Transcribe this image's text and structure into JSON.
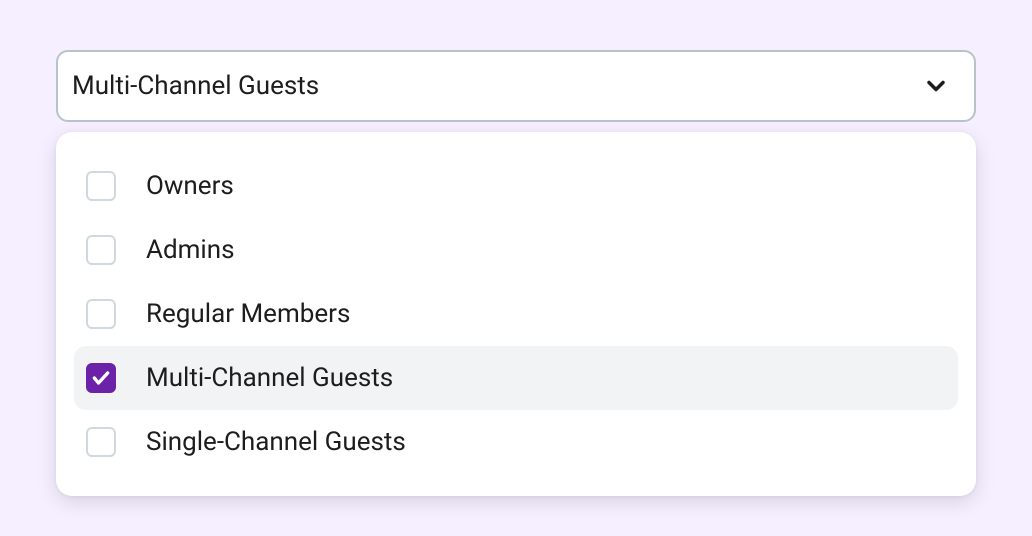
{
  "select": {
    "selected_label": "Multi-Channel Guests",
    "options": [
      {
        "label": "Owners",
        "checked": false
      },
      {
        "label": "Admins",
        "checked": false
      },
      {
        "label": "Regular Members",
        "checked": false
      },
      {
        "label": "Multi-Channel Guests",
        "checked": true
      },
      {
        "label": "Single-Channel Guests",
        "checked": false
      }
    ]
  }
}
